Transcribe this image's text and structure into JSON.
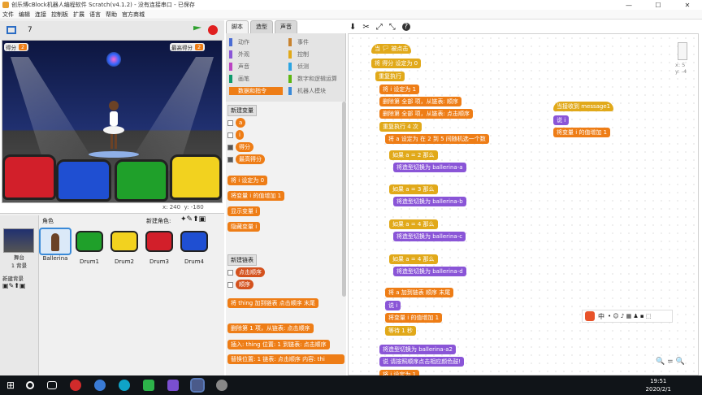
{
  "window": {
    "title": "创乐博cBlock机器人编程软件 Scratch(v4.1.2) - 没有连接串口 - 已保存",
    "min": "—",
    "max": "☐",
    "close": "✕"
  },
  "menu": [
    "文件",
    "编辑",
    "连接",
    "控制板",
    "扩展",
    "语言",
    "帮助",
    "官方商城"
  ],
  "toolbar": {
    "version": "7"
  },
  "stage": {
    "var1_label": "得分",
    "var1_value": "2",
    "var2_label": "最高得分",
    "var2_value": "2",
    "x": "x: 240",
    "y": "y: -180"
  },
  "sprites": {
    "header": "角色",
    "new_label": "新建角色:",
    "stage_label": "舞台",
    "stage_sub": "1 背景",
    "new_bg": "新建背景",
    "items": [
      {
        "name": "Ballerina"
      },
      {
        "name": "Drum1"
      },
      {
        "name": "Drum2"
      },
      {
        "name": "Drum3"
      },
      {
        "name": "Drum4"
      }
    ]
  },
  "tabs": [
    "脚本",
    "造型",
    "声音"
  ],
  "categories": [
    {
      "label": "动作",
      "color": "#4a6cd4"
    },
    {
      "label": "事件",
      "color": "#c88330"
    },
    {
      "label": "外观",
      "color": "#8a55d7"
    },
    {
      "label": "控制",
      "color": "#e1a91a"
    },
    {
      "label": "声音",
      "color": "#bb42c3"
    },
    {
      "label": "侦测",
      "color": "#2ca5e2"
    },
    {
      "label": "画笔",
      "color": "#0e9a6c"
    },
    {
      "label": "数字和逻辑运算",
      "color": "#5cb712"
    },
    {
      "label": "数据和指令",
      "color": "#ee7d16"
    },
    {
      "label": "机器人模块",
      "color": "#3a8ad8"
    }
  ],
  "palette": {
    "new_var": "新建变量",
    "vars": [
      "a",
      "i",
      "得分",
      "最高得分"
    ],
    "set_block": "将 i 设定为 0",
    "change_block": "将变量 i 的值增加 1",
    "show_var": "显示变量 i",
    "hide_var": "隐藏变量 i",
    "new_list": "新建链表",
    "lists": [
      "点击顺序",
      "顺序"
    ],
    "list_add": "将 thing 加到链表 点击顺序 末尾",
    "list_del": "删除第 1 项，从链表: 点击顺序",
    "list_insert": "插入: thing 位置: 1 到链表: 点击顺序",
    "list_replace": "替换位置: 1 链表: 点击顺序 内容: thi"
  },
  "script_main": [
    {
      "t": "当 🏳 被点击"
    },
    {
      "t": "将 得分 设定为 0"
    },
    {
      "t": "重复执行"
    },
    {
      "t": "将 i 设定为 1"
    },
    {
      "t": "删除第 全部 项，从链表: 顺序"
    },
    {
      "t": "删除第 全部 项，从链表: 点击顺序"
    },
    {
      "t": "重复执行 4 次"
    },
    {
      "t": "将 a 设定为 在 2 到 5 间随机选一个数"
    },
    {
      "t": "如果 a = 2 那么"
    },
    {
      "t": "将造型切换为 ballerina-a"
    },
    {
      "t": "如果 a = 3 那么"
    },
    {
      "t": "将造型切换为 ballerina-b"
    },
    {
      "t": "如果 a = 4 那么"
    },
    {
      "t": "将造型切换为 ballerina-c"
    },
    {
      "t": "如果 a = 4 那么"
    },
    {
      "t": "将造型切换为 ballerina-d"
    },
    {
      "t": "将 a 加到链表 顺序 末尾"
    },
    {
      "t": "说 i"
    },
    {
      "t": "将变量 i 的值增加 1"
    },
    {
      "t": "等待 1 秒"
    },
    {
      "t": "将造型切换为 ballerina-a2"
    },
    {
      "t": "说 请按照顺序点击相应颜色鼓!"
    },
    {
      "t": "将 i 设定为 1"
    }
  ],
  "script_side": [
    {
      "t": "当接收到 message1"
    },
    {
      "t": "说 i"
    },
    {
      "t": "将变量 i 的值增加 1"
    }
  ],
  "sprite_info": {
    "x": "x: 5",
    "y": "y: -4"
  },
  "taskbar": {
    "time": "19:51",
    "date": "2020/2/1"
  },
  "ime": {
    "label": "中"
  }
}
